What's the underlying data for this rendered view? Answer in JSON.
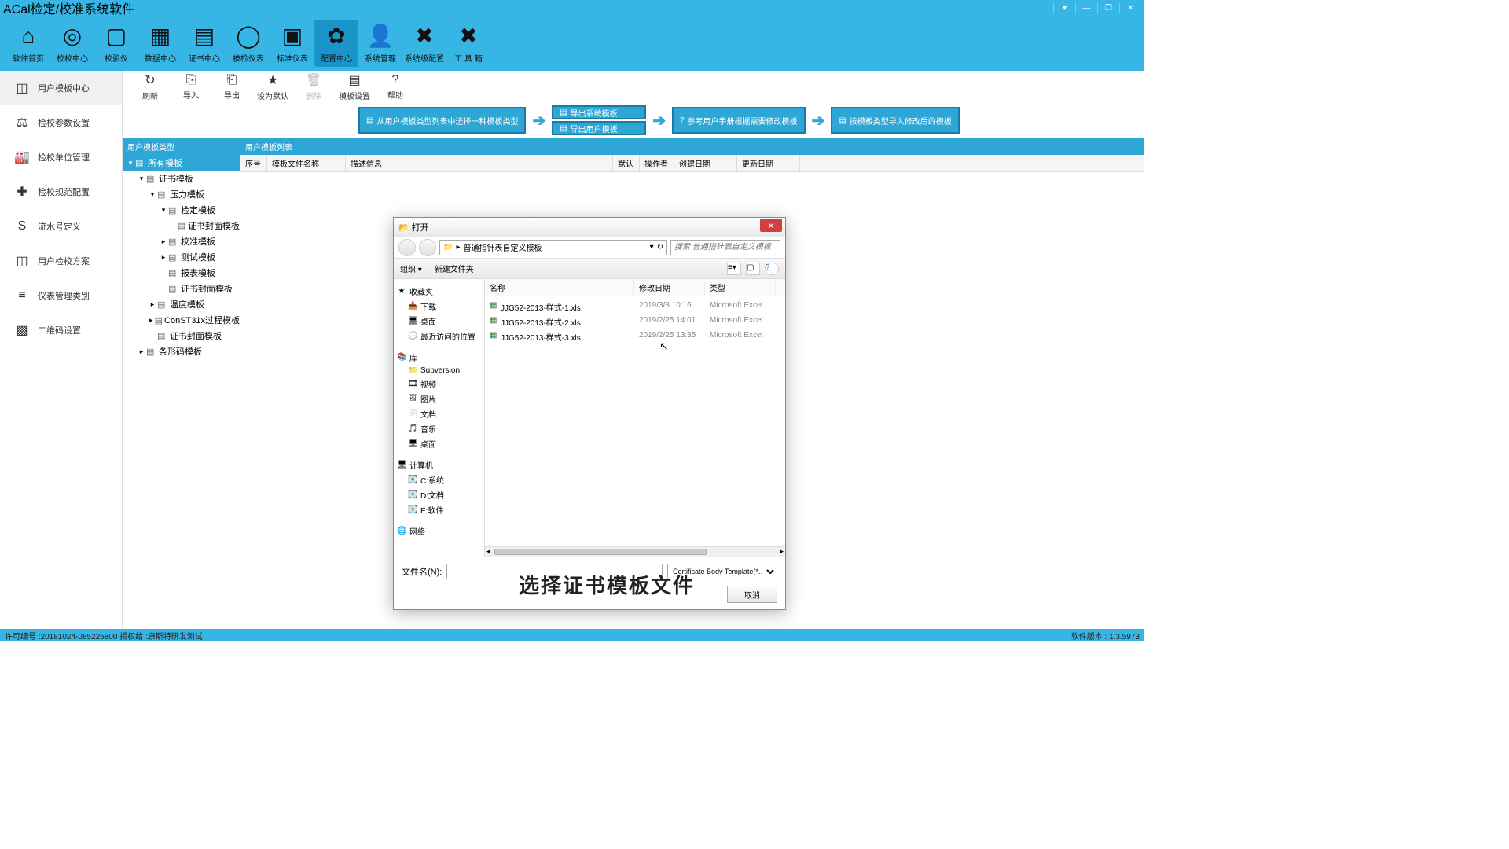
{
  "title": "ACal检定/校准系统软件",
  "mainTools": [
    {
      "label": "软件首页",
      "icon": "⌂"
    },
    {
      "label": "校校中心",
      "icon": "◎"
    },
    {
      "label": "校验仪",
      "icon": "▢"
    },
    {
      "label": "数据中心",
      "icon": "▦"
    },
    {
      "label": "证书中心",
      "icon": "▤"
    },
    {
      "label": "被检仪表",
      "icon": "◯"
    },
    {
      "label": "标准仪表",
      "icon": "▣"
    },
    {
      "label": "配置中心",
      "icon": "✿"
    },
    {
      "label": "系统管理",
      "icon": "👤"
    },
    {
      "label": "系统级配置",
      "icon": "✖"
    },
    {
      "label": "工 具 箱",
      "icon": "✖"
    }
  ],
  "subTools": [
    {
      "label": "刷新",
      "icon": "↻"
    },
    {
      "label": "导入",
      "icon": "⎘"
    },
    {
      "label": "导出",
      "icon": "⎗"
    },
    {
      "label": "设为默认",
      "icon": "★"
    },
    {
      "label": "删除",
      "icon": "🗑",
      "disabled": true
    },
    {
      "label": "模板设置",
      "icon": "▤"
    },
    {
      "label": "帮助",
      "icon": "?"
    }
  ],
  "flow": {
    "step1": "从用户模板类型列表中选择一种模板类型",
    "step2a": "导出系统模板",
    "step2b": "导出用户模板",
    "step3": "参考用户手册根据需要修改模板",
    "step4": "按模板类型导入修改后的模板"
  },
  "sidebar": [
    {
      "label": "用户模板中心",
      "icon": "◫"
    },
    {
      "label": "检校参数设置",
      "icon": "⚖"
    },
    {
      "label": "检校单位管理",
      "icon": "🏭"
    },
    {
      "label": "检校规范配置",
      "icon": "✚"
    },
    {
      "label": "流水号定义",
      "icon": "S"
    },
    {
      "label": "用户检校方案",
      "icon": "◫"
    },
    {
      "label": "仪表管理类别",
      "icon": "≡"
    },
    {
      "label": "二维码设置",
      "icon": "▩"
    }
  ],
  "treeHeader": "用户模板类型",
  "tree": {
    "root": "所有模板",
    "items": [
      {
        "label": "证书模板",
        "indent": 1,
        "expanded": true
      },
      {
        "label": "压力模板",
        "indent": 2,
        "expanded": true
      },
      {
        "label": "检定模板",
        "indent": 3,
        "expanded": true
      },
      {
        "label": "证书封面模板",
        "indent": 4
      },
      {
        "label": "校准模板",
        "indent": 3,
        "collapsed": true
      },
      {
        "label": "测试模板",
        "indent": 3,
        "collapsed": true
      },
      {
        "label": "报表模板",
        "indent": 3
      },
      {
        "label": "证书封面模板",
        "indent": 3
      },
      {
        "label": "温度模板",
        "indent": 2,
        "collapsed": true
      },
      {
        "label": "ConST31x过程模板",
        "indent": 2,
        "collapsed": true
      },
      {
        "label": "证书封面模板",
        "indent": 2
      },
      {
        "label": "条形码模板",
        "indent": 1,
        "collapsed": true
      }
    ]
  },
  "listHeader": "用户模板列表",
  "listCols": [
    "序号",
    "模板文件名称",
    "描述信息",
    "默认",
    "操作者",
    "创建日期",
    "更新日期"
  ],
  "fileDialog": {
    "title": "打开",
    "path": "普通指针表自定义模板",
    "searchPlaceholder": "搜索 普通指针表自定义模板",
    "organize": "组织 ▾",
    "newFolder": "新建文件夹",
    "sideGroups": [
      {
        "head": "收藏夹",
        "icon": "★",
        "items": [
          {
            "label": "下载",
            "icon": "📥"
          },
          {
            "label": "桌面",
            "icon": "🖥"
          },
          {
            "label": "最近访问的位置",
            "icon": "🕓"
          }
        ]
      },
      {
        "head": "库",
        "icon": "📚",
        "items": [
          {
            "label": "Subversion",
            "icon": "📁"
          },
          {
            "label": "视频",
            "icon": "🎞"
          },
          {
            "label": "图片",
            "icon": "🖼"
          },
          {
            "label": "文档",
            "icon": "📄"
          },
          {
            "label": "音乐",
            "icon": "🎵"
          },
          {
            "label": "桌面",
            "icon": "🖥"
          }
        ]
      },
      {
        "head": "计算机",
        "icon": "🖥",
        "items": [
          {
            "label": "C:系统",
            "icon": "💽"
          },
          {
            "label": "D:文档",
            "icon": "💽"
          },
          {
            "label": "E:软件",
            "icon": "💽"
          }
        ]
      },
      {
        "head": "网络",
        "icon": "🌐",
        "items": []
      }
    ],
    "cols": [
      "名称",
      "修改日期",
      "类型"
    ],
    "files": [
      {
        "name": "JJG52-2013-样式-1.xls",
        "date": "2019/3/8 10:16",
        "type": "Microsoft Excel"
      },
      {
        "name": "JJG52-2013-样式-2.xls",
        "date": "2019/2/25 14:01",
        "type": "Microsoft Excel"
      },
      {
        "name": "JJG52-2013-样式-3.xls",
        "date": "2019/2/25 13:35",
        "type": "Microsoft Excel"
      }
    ],
    "fileNameLabel": "文件名(N):",
    "filter": "Certificate Body Template(*.…",
    "cancel": "取消"
  },
  "overlayCaption": "选择证书模板文件",
  "status": {
    "left": "许可编号 :20181024-085225800   授权给 :康斯特研发测试",
    "right": "软件版本 : 1.3.5973"
  }
}
